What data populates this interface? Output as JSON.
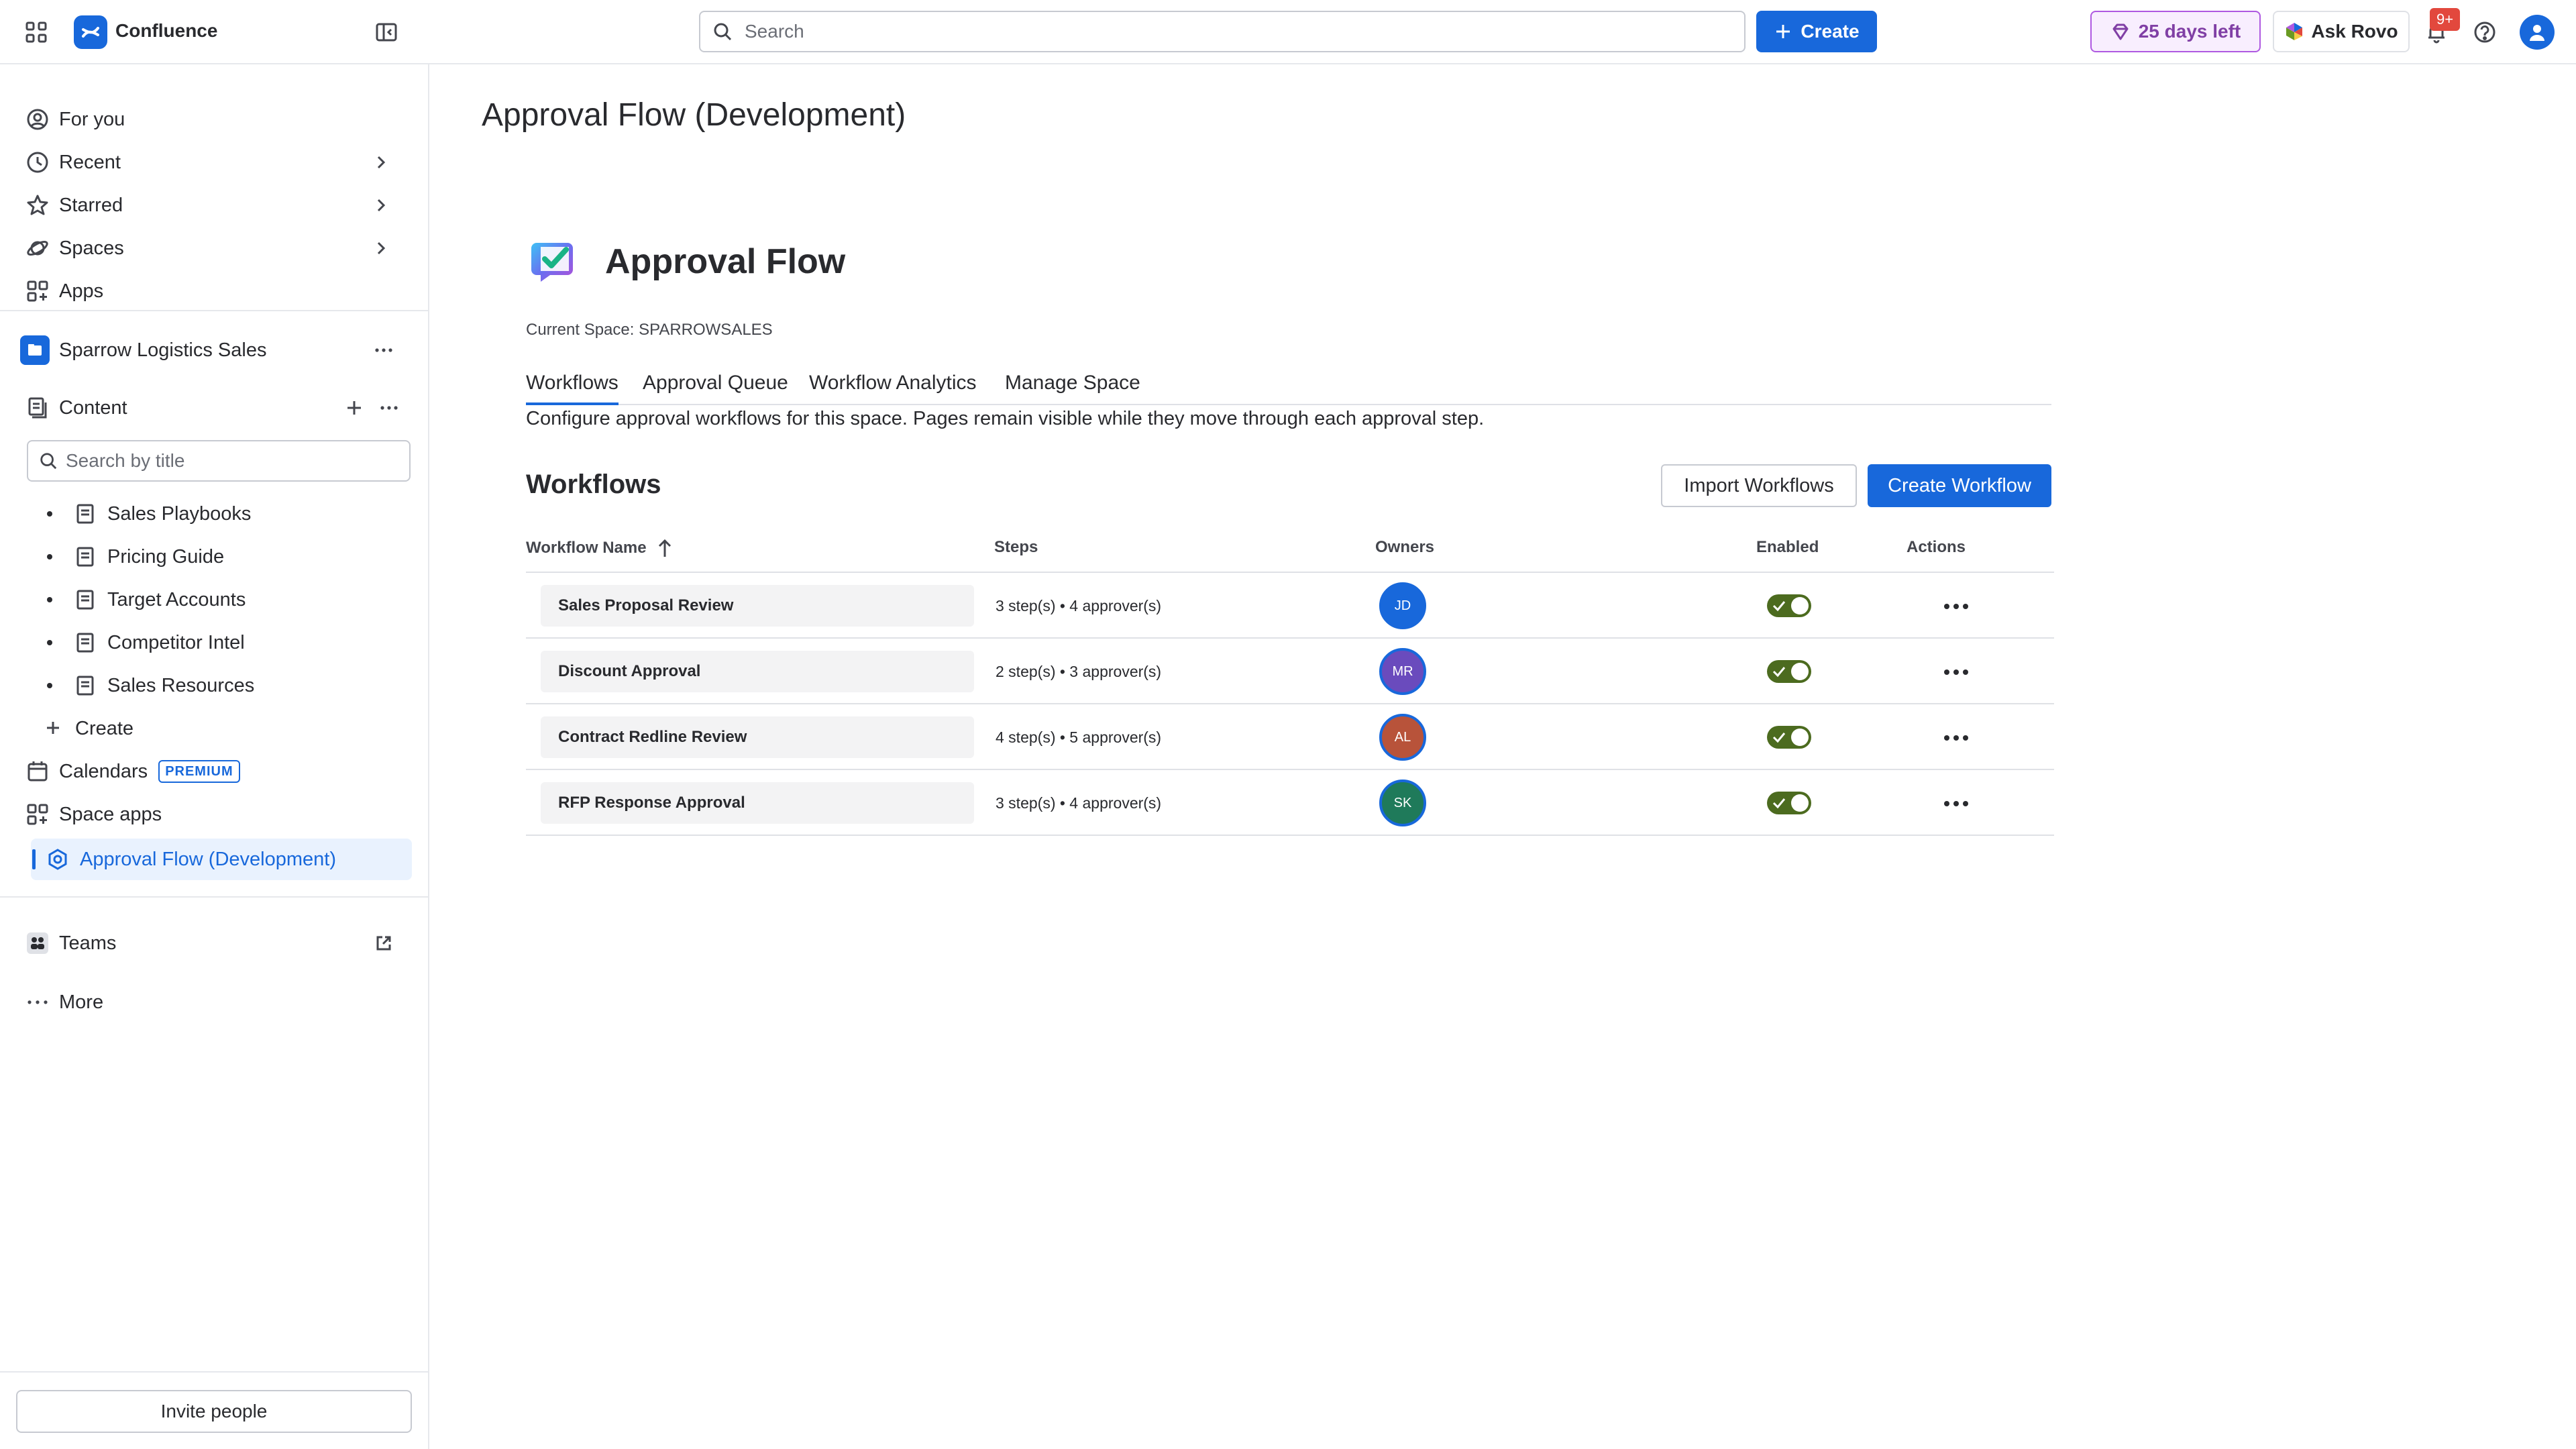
{
  "topbar": {
    "brand": "Confluence",
    "search_placeholder": "Search",
    "create_label": "Create",
    "trial_label": "25 days left",
    "rovo_label": "Ask Rovo",
    "notification_count": "9+"
  },
  "sidebar": {
    "nav": [
      {
        "label": "For you",
        "icon": "person-circle-icon"
      },
      {
        "label": "Recent",
        "icon": "clock-icon"
      },
      {
        "label": "Starred",
        "icon": "star-icon"
      },
      {
        "label": "Spaces",
        "icon": "planet-icon"
      },
      {
        "label": "Apps",
        "icon": "apps-grid-icon"
      }
    ],
    "space_name": "Sparrow Logistics Sales",
    "content_label": "Content",
    "search_placeholder": "Search by title",
    "pages": [
      "Sales Playbooks",
      "Pricing Guide",
      "Target Accounts",
      "Competitor Intel",
      "Sales Resources"
    ],
    "create_label": "Create",
    "calendars_label": "Calendars",
    "premium_badge": "PREMIUM",
    "space_apps_label": "Space apps",
    "active_app_label": "Approval Flow (Development)",
    "teams_label": "Teams",
    "more_label": "More",
    "invite_label": "Invite people"
  },
  "main": {
    "page_title": "Approval Flow (Development)",
    "app_title": "Approval Flow",
    "current_space": "Current Space: SPARROWSALES",
    "tabs": [
      "Workflows",
      "Approval Queue",
      "Workflow Analytics",
      "Manage Space"
    ],
    "active_tab": "Workflows",
    "description": "Configure approval workflows for this space. Pages remain visible while they move through each approval step.",
    "section_title": "Workflows",
    "import_label": "Import Workflows",
    "create_workflow_label": "Create Workflow",
    "columns": {
      "name": "Workflow Name",
      "steps": "Steps",
      "owners": "Owners",
      "enabled": "Enabled",
      "actions": "Actions"
    },
    "rows": [
      {
        "name": "Sales Proposal Review",
        "steps": "3 step(s) • 4 approver(s)",
        "owner": "JD",
        "owner_color": "#1868db",
        "enabled": true
      },
      {
        "name": "Discount Approval",
        "steps": "2 step(s) • 3 approver(s)",
        "owner": "MR",
        "owner_color": "#6a4bbd",
        "enabled": true
      },
      {
        "name": "Contract Redline Review",
        "steps": "4 step(s) • 5 approver(s)",
        "owner": "AL",
        "owner_color": "#b8533a",
        "enabled": true
      },
      {
        "name": "RFP Response Approval",
        "steps": "3 step(s) • 4 approver(s)",
        "owner": "SK",
        "owner_color": "#1f7a5a",
        "enabled": true
      }
    ]
  },
  "colors": {
    "accent": "#1868db",
    "active_bg": "#e9f2fe",
    "toggle_on": "#4c6b1f",
    "trial_border": "#af59e1",
    "badge_red": "#e2483d"
  }
}
